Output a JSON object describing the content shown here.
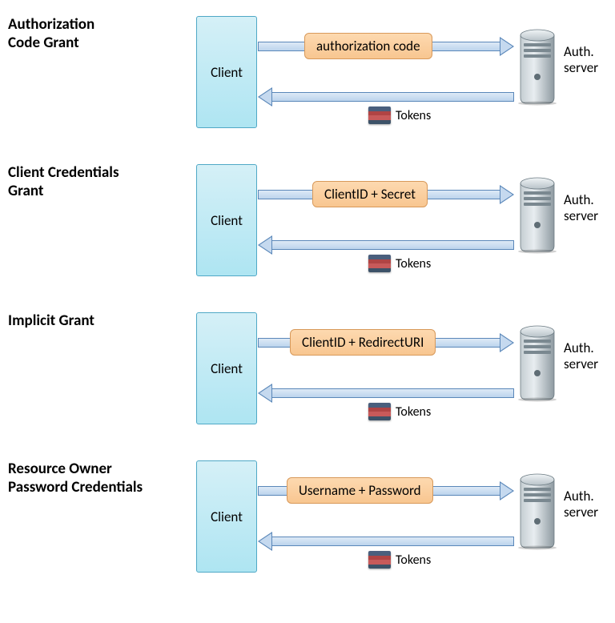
{
  "common": {
    "client_label": "Client",
    "server_label": "Auth.\nserver",
    "tokens_label": "Tokens"
  },
  "flows": [
    {
      "title": "Authorization\nCode Grant",
      "payload": "authorization code"
    },
    {
      "title": "Client Credentials\nGrant",
      "payload": "ClientID + Secret"
    },
    {
      "title": "Implicit Grant",
      "payload": "ClientID + RedirectURI"
    },
    {
      "title": "Resource Owner\nPassword Credentials",
      "payload": "Username + Password"
    }
  ]
}
